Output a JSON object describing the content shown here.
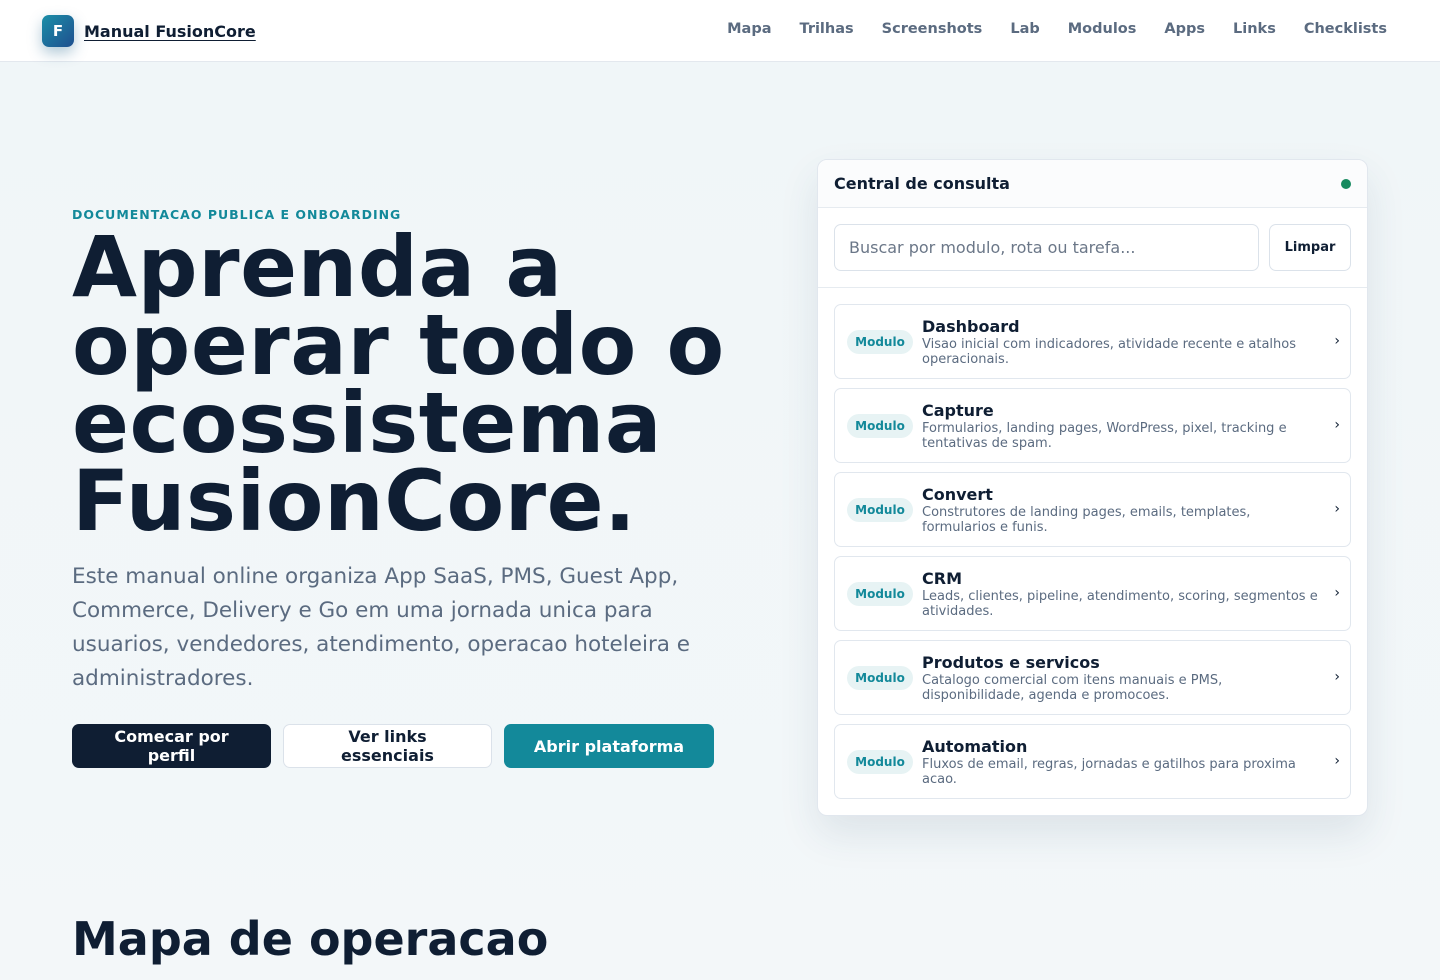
{
  "header": {
    "logo_letter": "F",
    "brand": "Manual FusionCore",
    "nav": [
      "Mapa",
      "Trilhas",
      "Screenshots",
      "Lab",
      "Modulos",
      "Apps",
      "Links",
      "Checklists"
    ]
  },
  "hero": {
    "eyebrow": "DOCUMENTACAO PUBLICA E ONBOARDING",
    "title": "Aprenda a operar todo o ecossistema FusionCore.",
    "text": "Este manual online organiza App SaaS, PMS, Guest App, Commerce, Delivery e Go em uma jornada unica para usuarios, vendedores, atendimento, operacao hoteleira e administradores.",
    "buttons": {
      "primary": "Comecar por perfil",
      "secondary": "Ver links essenciais",
      "accent": "Abrir plataforma"
    }
  },
  "panel": {
    "title": "Central de consulta",
    "search_placeholder": "Buscar por modulo, rota ou tarefa...",
    "clear_label": "Limpar",
    "items": [
      {
        "badge": "Modulo",
        "title": "Dashboard",
        "desc": "Visao inicial com indicadores, atividade recente e atalhos operacionais."
      },
      {
        "badge": "Modulo",
        "title": "Capture",
        "desc": "Formularios, landing pages, WordPress, pixel, tracking e tentativas de spam."
      },
      {
        "badge": "Modulo",
        "title": "Convert",
        "desc": "Construtores de landing pages, emails, templates, formularios e funis."
      },
      {
        "badge": "Modulo",
        "title": "CRM",
        "desc": "Leads, clientes, pipeline, atendimento, scoring, segmentos e atividades."
      },
      {
        "badge": "Modulo",
        "title": "Produtos e servicos",
        "desc": "Catalogo comercial com itens manuais e PMS, disponibilidade, agenda e promocoes."
      },
      {
        "badge": "Modulo",
        "title": "Automation",
        "desc": "Fluxos de email, regras, jornadas e gatilhos para proxima acao."
      }
    ]
  },
  "section": {
    "title": "Mapa de operacao"
  },
  "colors": {
    "accent": "#13899a",
    "dark": "#0f1e33",
    "status": "#168a5f"
  }
}
